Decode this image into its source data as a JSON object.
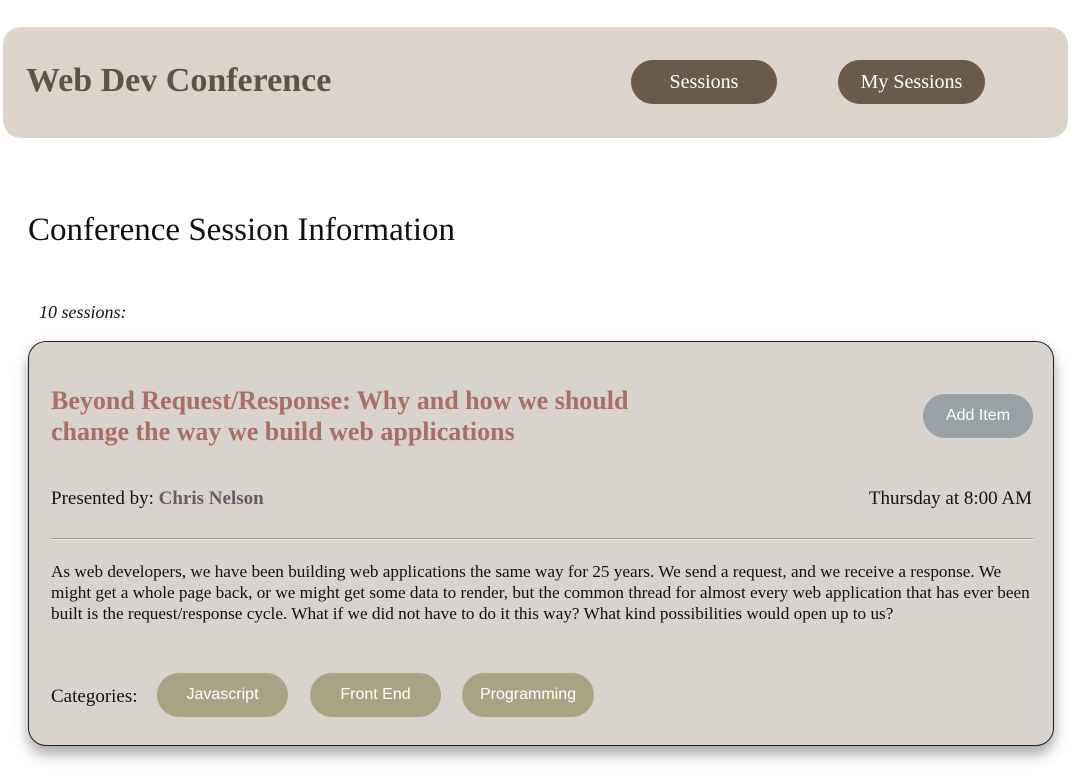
{
  "header": {
    "site_title": "Web Dev Conference",
    "nav": {
      "sessions": "Sessions",
      "my_sessions": "My Sessions"
    }
  },
  "main": {
    "heading": "Conference Session Information",
    "session_count": "10 sessions:"
  },
  "session": {
    "title": "Beyond Request/Response: Why and how we should change the way we build web applications",
    "add_button": "Add Item",
    "presenter_label": "Presented by:",
    "presenter_name": "Chris Nelson",
    "time": "Thursday at 8:00 AM",
    "description": "As web developers, we have been building web applications the same way for 25 years. We send a request, and we receive a response. We might get a whole page back, or we might get some data to render, but the common thread for almost every web application that has ever been built is the request/response cycle. What if we did not have to do it this way? What kind possibilities would open up to us?",
    "categories_label": "Categories:",
    "categories": [
      "Javascript",
      "Front End",
      "Programming"
    ]
  },
  "colors": {
    "header_bg": "#dcd4cb",
    "nav_button": "#6a5a47",
    "card_bg": "#d9d3ce",
    "title_accent": "#a86f62",
    "presenter_accent": "#6c5a63",
    "add_button": "#98a2a6",
    "category_tag": "#a8a382"
  }
}
